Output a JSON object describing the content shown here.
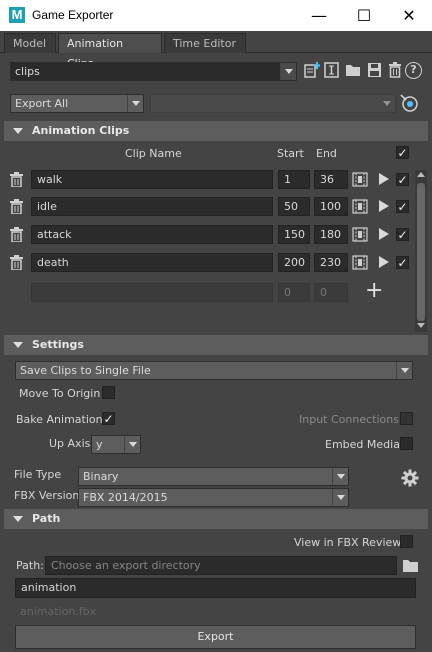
{
  "window": {
    "app_icon_letter": "M",
    "title": "Game Exporter",
    "minimize": "—",
    "maximize": "☐",
    "close": "✕"
  },
  "tabs": [
    {
      "label": "Model",
      "active": false
    },
    {
      "label": "Animation Clips",
      "active": true
    },
    {
      "label": "Time Editor",
      "active": false
    }
  ],
  "preset": {
    "value": "clips",
    "icons": [
      "add-preset-icon",
      "edit-preset-icon",
      "open-folder-icon",
      "save-icon",
      "delete-icon",
      "help-icon"
    ],
    "help": "?"
  },
  "export_filter": {
    "value": "Export All",
    "secondary_value": ""
  },
  "animation_clips": {
    "header": "Animation Clips",
    "columns": {
      "clip_name": "Clip Name",
      "start": "Start",
      "end": "End"
    },
    "clips": [
      {
        "name": "walk",
        "start": "1",
        "end": "36",
        "checked": true
      },
      {
        "name": "idle",
        "start": "50",
        "end": "100",
        "checked": true
      },
      {
        "name": "attack",
        "start": "150",
        "end": "180",
        "checked": true
      },
      {
        "name": "death",
        "start": "200",
        "end": "230",
        "checked": true
      }
    ],
    "new_row": {
      "start": "0",
      "end": "0"
    },
    "add": "+"
  },
  "settings": {
    "header": "Settings",
    "save_mode": "Save Clips to Single File",
    "move_to_origin": "Move To Origin",
    "bake_animation": "Bake Animation",
    "bake_checked": true,
    "input_connections": "Input Connections",
    "up_axis_label": "Up Axis",
    "up_axis_value": "y",
    "embed_media": "Embed Media",
    "file_type_label": "File Type",
    "file_type_value": "Binary",
    "fbx_version_label": "FBX Version",
    "fbx_version_value": "FBX 2014/2015"
  },
  "path": {
    "header": "Path",
    "view_in_fbx_review": "View in FBX Review",
    "path_label": "Path:",
    "path_placeholder": "Choose an export directory",
    "file_name": "animation",
    "file_preview": "animation.fbx",
    "export_button": "Export"
  },
  "colors": {
    "background": "#444444",
    "section_header": "#5d5d5d",
    "field": "#2b2b2b",
    "app_icon": "#1f9fb4"
  }
}
